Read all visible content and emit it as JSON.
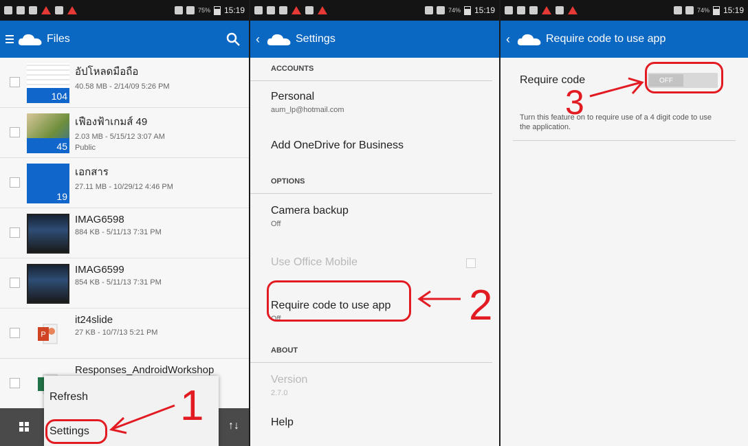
{
  "status": {
    "time": "15:19",
    "battery_left": "75%",
    "battery_mid": "74%",
    "battery_right": "74%"
  },
  "files_panel": {
    "title": "Files",
    "files": [
      {
        "name": "อัปโหลดมือถือ",
        "meta": "40.58 MB - 2/14/09 5:26 PM",
        "extra": "",
        "count": "104",
        "thumb": "img"
      },
      {
        "name": "เฟืองฟ้าเกมส์ 49",
        "meta": "2.03 MB - 5/15/12 3:07 AM",
        "extra": "Public",
        "count": "45",
        "thumb": "photo"
      },
      {
        "name": "เอกสาร",
        "meta": "27.11 MB - 10/29/12 4:46 PM",
        "extra": "",
        "count": "19",
        "thumb": "folder"
      },
      {
        "name": "IMAG6598",
        "meta": "884 KB - 5/11/13 7:31 PM",
        "extra": "",
        "count": "",
        "thumb": "screen"
      },
      {
        "name": "IMAG6599",
        "meta": "854 KB - 5/11/13 7:31 PM",
        "extra": "",
        "count": "",
        "thumb": "screen"
      },
      {
        "name": "it24slide",
        "meta": "27 KB - 10/7/13 5:21 PM",
        "extra": "",
        "count": "",
        "thumb": "ppt"
      },
      {
        "name": "Responses_AndroidWorkshop",
        "meta": "",
        "extra": "",
        "count": "",
        "thumb": "xls"
      }
    ],
    "popup": {
      "refresh": "Refresh",
      "settings": "Settings"
    }
  },
  "settings_panel": {
    "title": "Settings",
    "accounts_header": "ACCOUNTS",
    "personal_title": "Personal",
    "personal_sub": "aum_lp@hotmail.com",
    "add_business": "Add OneDrive for Business",
    "options_header": "OPTIONS",
    "camera_title": "Camera backup",
    "camera_sub": "Off",
    "office_title": "Use Office Mobile",
    "require_title": "Require code to use app",
    "require_sub": "Off",
    "about_header": "ABOUT",
    "version_title": "Version",
    "version_sub": "2.7.0",
    "help_title": "Help"
  },
  "require_panel": {
    "title": "Require code to use app",
    "require_label": "Require code",
    "toggle_state": "OFF",
    "description": "Turn this feature on to require use of a 4 digit code to use the application."
  },
  "annotations": {
    "step1": "1",
    "step2": "2",
    "step3": "3"
  },
  "colors": {
    "appbar": "#0a67c2",
    "annotation": "#e21b23",
    "folder": "#1166cc"
  }
}
